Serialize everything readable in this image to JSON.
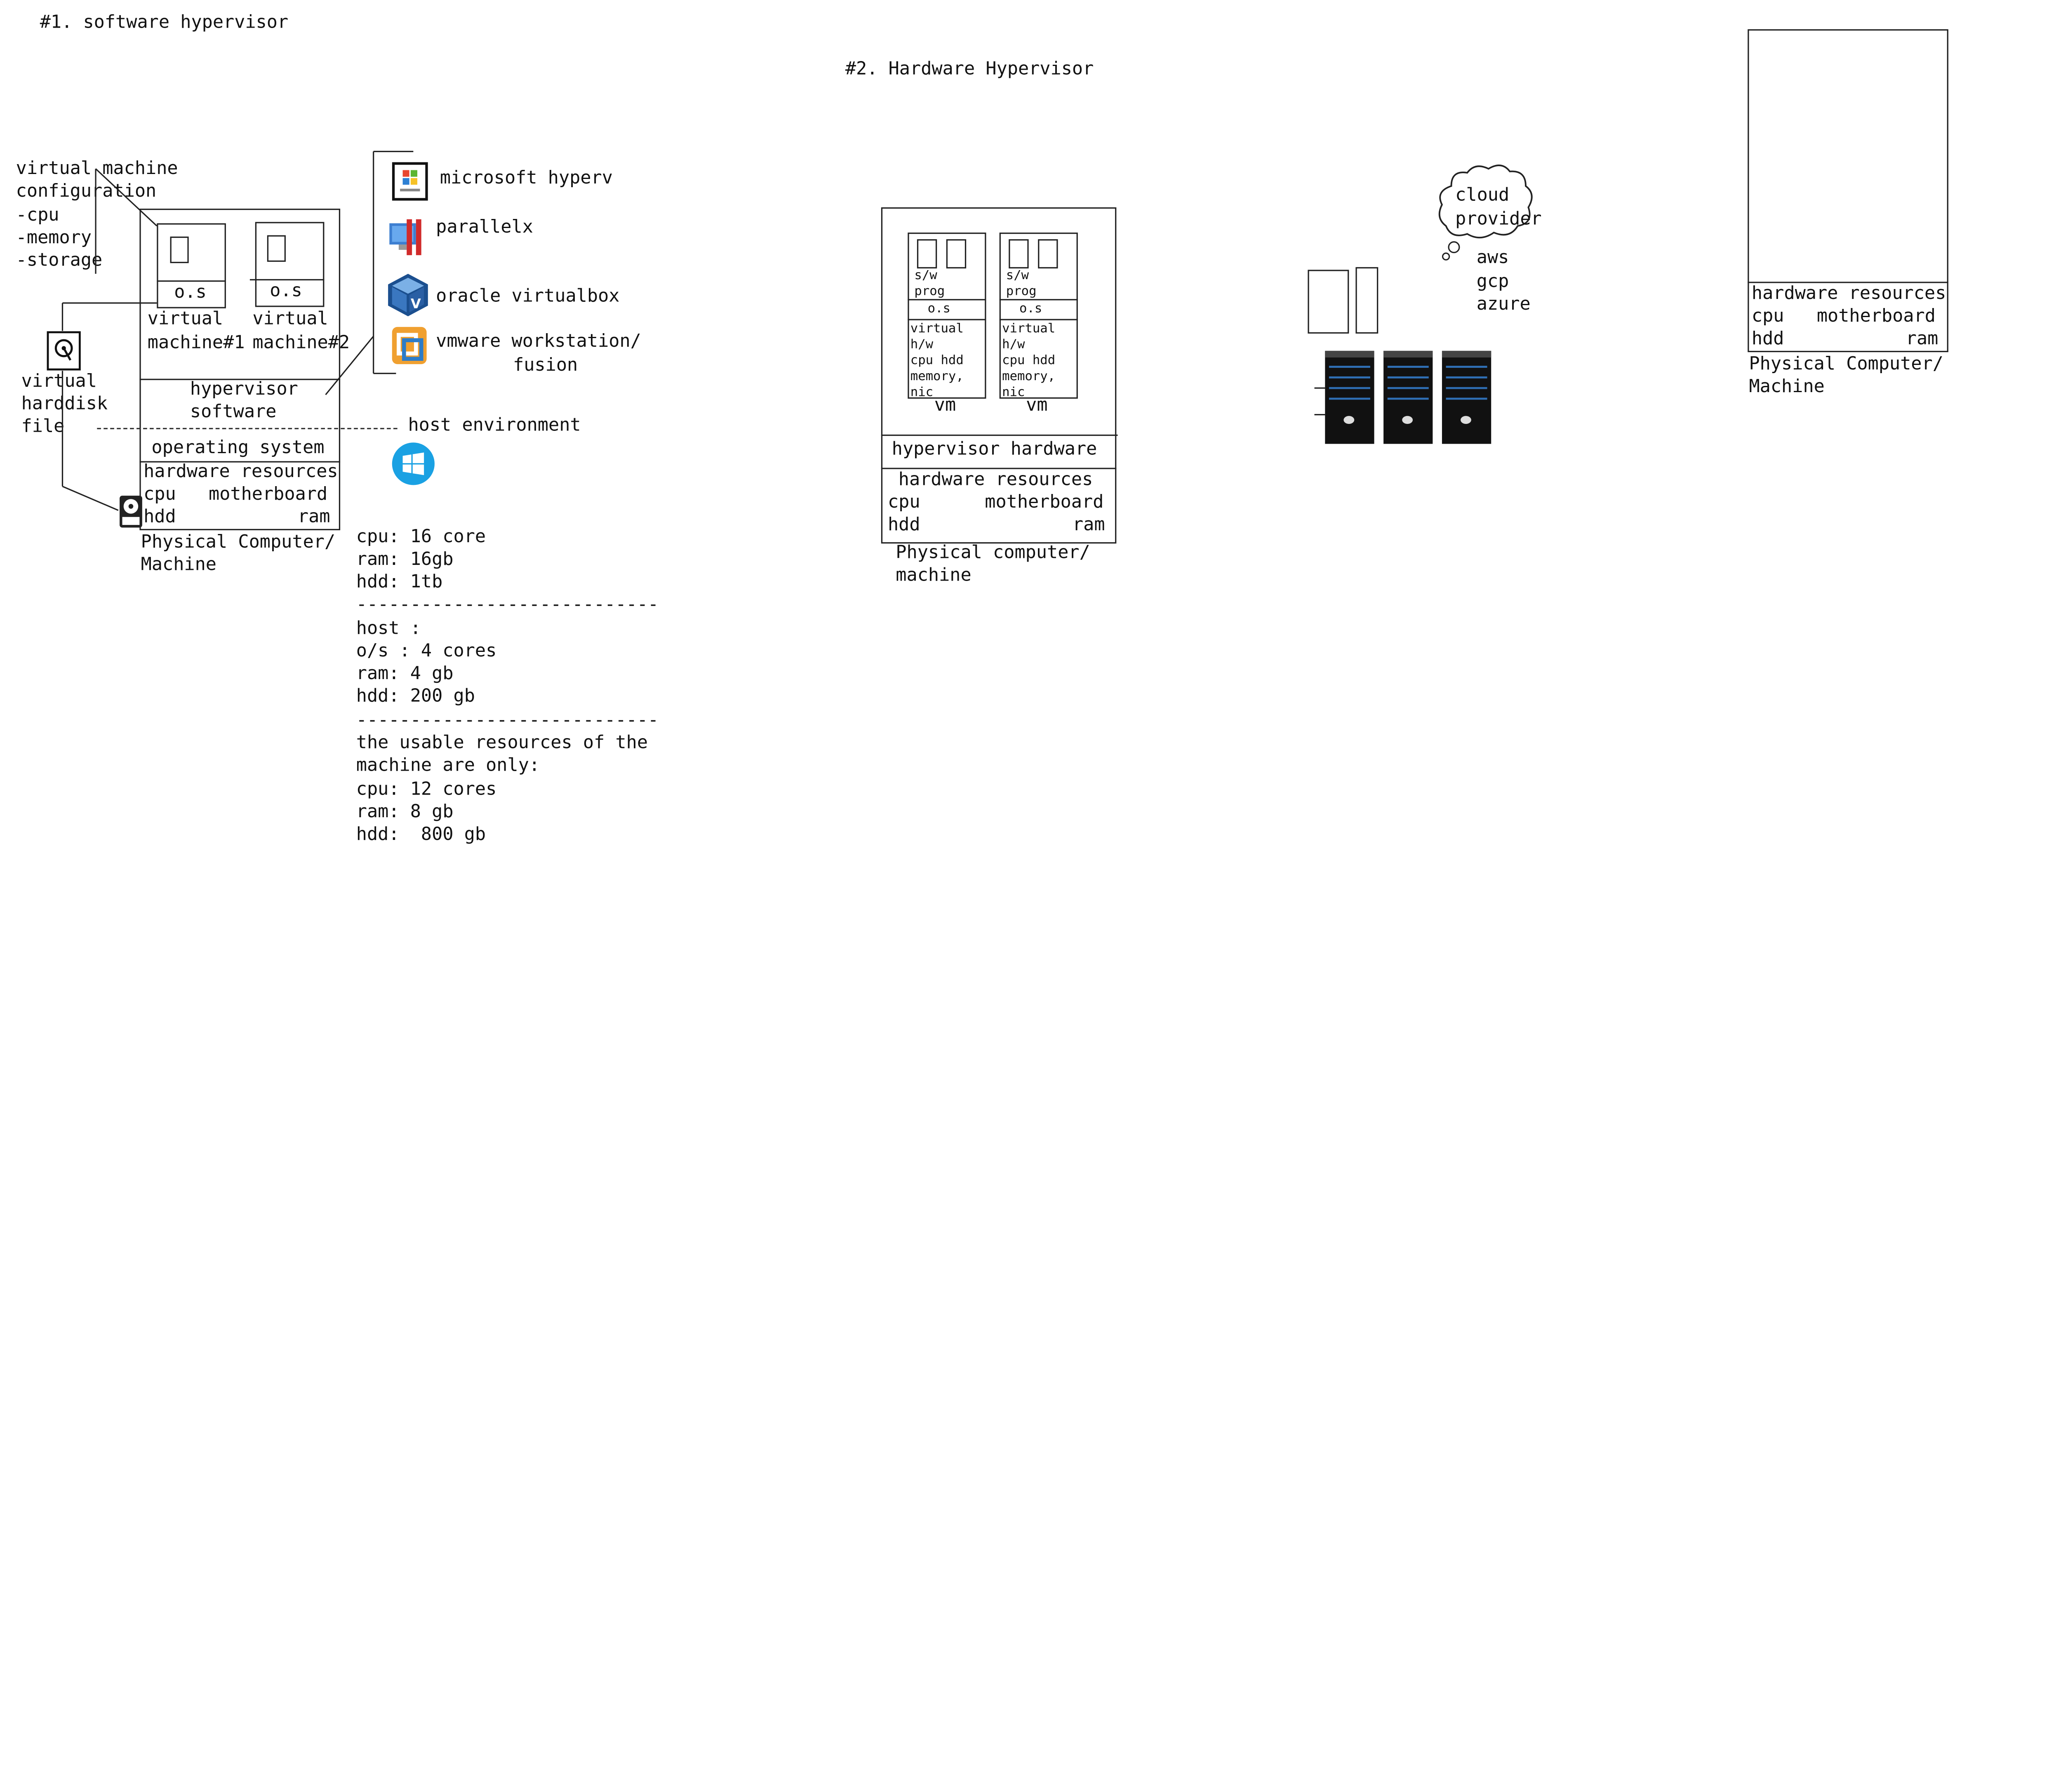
{
  "titles": {
    "software": "#1. software hypervisor",
    "hardware": "#2. Hardware Hypervisor"
  },
  "sw": {
    "vm_config": [
      "virtual machine",
      "configuration",
      "-cpu",
      "-memory",
      "-storage"
    ],
    "vm_os": "o.s",
    "vm1_label": [
      "virtual",
      "machine#1"
    ],
    "vm2_label": [
      "virtual",
      "machine#2"
    ],
    "hypervisor": [
      "hypervisor",
      "software"
    ],
    "operating_system": "operating system",
    "hw_resources": "hardware resources",
    "hw_row1_left": "cpu",
    "hw_row1_right": "motherboard",
    "hw_row2_left": "hdd",
    "hw_row2_right": "ram",
    "physical": [
      "Physical Computer/",
      "Machine"
    ],
    "vdisk": [
      "virtual",
      "harddisk",
      "file"
    ],
    "host_env": "host environment",
    "products": [
      {
        "label": "microsoft hyperv",
        "icon": "hyperv-icon"
      },
      {
        "label": "parallelx",
        "icon": "parallels-icon"
      },
      {
        "label": "oracle virtualbox",
        "icon": "virtualbox-icon"
      },
      {
        "label": "vmware workstation/",
        "label2": "fusion",
        "icon": "vmware-icon"
      }
    ],
    "resources": [
      "cpu: 16 core",
      "ram: 16gb",
      "hdd: 1tb",
      "----------------------------",
      "host :",
      "o/s : 4 cores",
      "ram: 4 gb",
      "hdd: 200 gb",
      "----------------------------",
      "the usable resources of the",
      "machine are only:",
      "cpu: 12 cores",
      "ram: 8 gb",
      "hdd:  800 gb"
    ]
  },
  "hw": {
    "vm_prog": [
      "s/w",
      "prog"
    ],
    "vm_os": "o.s",
    "vm_virtual": [
      "virtual",
      "h/w",
      "cpu hdd",
      "memory,",
      "nic"
    ],
    "vm_label": "vm",
    "hypervisor": "hypervisor hardware",
    "hw_resources": "hardware resources",
    "hw_row1_left": "cpu",
    "hw_row1_right": "motherboard",
    "hw_row2_left": "hdd",
    "hw_row2_right": "ram",
    "physical": [
      "Physical computer/",
      "machine"
    ]
  },
  "cloud": {
    "bubble": [
      "cloud",
      "provider"
    ],
    "providers": [
      "aws",
      "gcp",
      "azure"
    ]
  },
  "right_machine": {
    "hw_resources": "hardware resources",
    "hw_row1_left": "cpu",
    "hw_row1_right": "motherboard",
    "hw_row2_left": "hdd",
    "hw_row2_right": "ram",
    "physical": [
      "Physical Computer/",
      "Machine"
    ]
  }
}
